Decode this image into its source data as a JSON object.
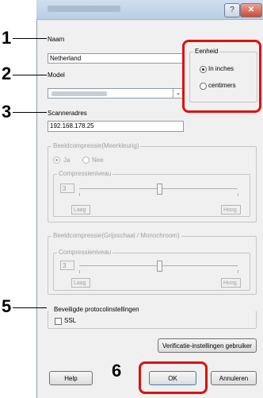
{
  "window": {
    "help_glyph": "?",
    "close_glyph": "✕"
  },
  "callouts": [
    "1",
    "2",
    "3",
    "5",
    "6"
  ],
  "form": {
    "name_label": "Naam",
    "name_value": "Netherland",
    "model_label": "Model",
    "scanner_label": "Scanneradres",
    "scanner_value": "192.168.178.25"
  },
  "unit": {
    "title": "Eenheid",
    "option_inches": "In inches",
    "option_cm": "centimers"
  },
  "color_compression": {
    "title": "Beeldcompressie(Meerkleurig)",
    "yes": "Ja",
    "no": "Nee",
    "level_title": "Compressieniveau",
    "level_value": "3",
    "low": "Laag",
    "high": "Hoog"
  },
  "gray_compression": {
    "title": "Beeldcompressie(Grijsschaal / Monochroom)",
    "level_title": "Compressieniveau",
    "level_value": "3",
    "low": "Laag",
    "high": "Hoog"
  },
  "security": {
    "title": "Beveiligde protocolinstellingen",
    "ssl_label": "SSL"
  },
  "buttons": {
    "verify": "Verificatie-instellingen gebruiker",
    "help": "Help",
    "ok": "OK",
    "cancel": "Annuleren"
  },
  "colors": {
    "highlight": "#e01010",
    "window_bg": "#f0f0f0"
  }
}
